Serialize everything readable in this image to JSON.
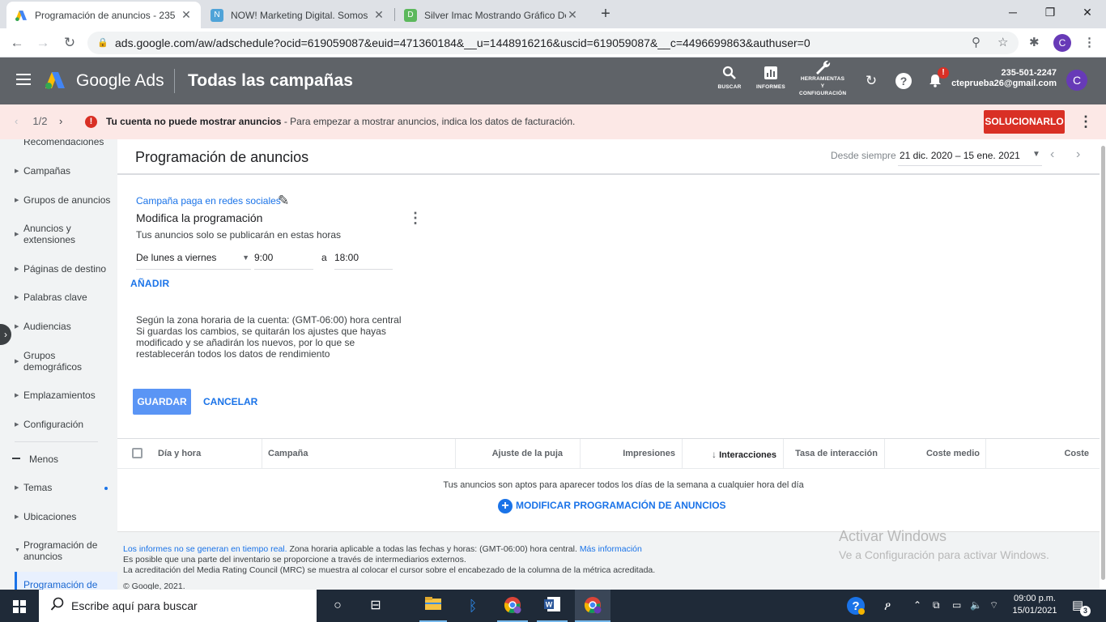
{
  "browser": {
    "tabs": [
      {
        "title": "Programación de anuncios - 235",
        "active": true,
        "favicon": "google-ads-icon"
      },
      {
        "title": "NOW! Marketing Digital. Somos",
        "active": false,
        "favicon": "now-marketing-icon"
      },
      {
        "title": "Silver Imac Mostrando Gráfico De",
        "active": false,
        "favicon": "d-icon"
      }
    ],
    "url": "ads.google.com/aw/adschedule?ocid=619059087&euid=471360184&__u=1448916216&uscid=619059087&__c=4496699863&authuser=0",
    "profile_initial": "C"
  },
  "header": {
    "brand": "Google Ads",
    "title": "Todas las campañas",
    "tools": [
      {
        "label": "BUSCAR",
        "icon": "search-icon"
      },
      {
        "label": "INFORMES",
        "icon": "reports-icon"
      },
      {
        "label": "HERRAMIENTAS Y CONFIGURACIÓN",
        "icon": "wrench-icon"
      }
    ],
    "notification_badge": "!",
    "account_id": "235-501-2247",
    "account_email": "cteprueba26@gmail.com",
    "avatar_initial": "C"
  },
  "alert": {
    "pager": "1/2",
    "title": "Tu cuenta no puede mostrar anuncios",
    "message": " - Para empezar a mostrar anuncios, indica los datos de facturación.",
    "button": "SOLUCIONARLO"
  },
  "sidebar": {
    "items": [
      {
        "label": "Recomendaciones"
      },
      {
        "label": "Campañas"
      },
      {
        "label": "Grupos de anuncios"
      },
      {
        "label": "Anuncios y extensiones"
      },
      {
        "label": "Páginas de destino"
      },
      {
        "label": "Palabras clave"
      },
      {
        "label": "Audiencias"
      },
      {
        "label": "Grupos demográficos"
      },
      {
        "label": "Emplazamientos"
      },
      {
        "label": "Configuración"
      }
    ],
    "less_label": "Menos",
    "more_items": [
      {
        "label": "Temas"
      },
      {
        "label": "Ubicaciones"
      },
      {
        "label": "Programación de anuncios"
      }
    ],
    "active_item": "Programación de"
  },
  "main": {
    "title": "Programación de anuncios",
    "date_range_label": "Desde siempre",
    "date_range_value": "21 dic. 2020 – 15 ene. 2021",
    "campaign_link": "Campaña paga en redes sociales",
    "schedule_title": "Modifica la programación",
    "schedule_subtitle": "Tus anuncios solo se publicarán en estas horas",
    "days_value": "De lunes a viernes",
    "start_time": "9:00",
    "to_label": "a",
    "end_time": "18:00",
    "add_label": "AÑADIR",
    "timezone_note": "Según la zona horaria de la cuenta: (GMT-06:00) hora central",
    "warning_note": "Si guardas los cambios, se quitarán los ajustes que hayas modificado y se añadirán los nuevos, por lo que se restablecerán todos los datos de rendimiento",
    "save_label": "GUARDAR",
    "cancel_label": "CANCELAR"
  },
  "table": {
    "columns": [
      "Día y hora",
      "Campaña",
      "Ajuste de la puja",
      "Impresiones",
      "Interacciones",
      "Tasa de interacción",
      "Coste medio",
      "Coste"
    ],
    "sorted_column": "Interacciones",
    "empty_message": "Tus anuncios son aptos para aparecer todos los días de la semana a cualquier hora del día",
    "modify_link": "MODIFICAR PROGRAMACIÓN DE ANUNCIOS"
  },
  "footer": {
    "line1_link": "Los informes no se generan en tiempo real.",
    "line1_text": " Zona horaria aplicable a todas las fechas y horas: (GMT-06:00) hora central. ",
    "line1_more": "Más información",
    "line2": "Es posible que una parte del inventario se proporcione a través de intermediarios externos.",
    "line3": "La acreditación del Media Rating Council (MRC) se muestra al colocar el cursor sobre el encabezado de la columna de la métrica acreditada.",
    "copyright": "© Google, 2021."
  },
  "watermark": {
    "title": "Activar Windows",
    "subtitle": "Ve a Configuración para activar Windows."
  },
  "taskbar": {
    "search_placeholder": "Escribe aquí para buscar",
    "time": "09:00 p.m.",
    "date": "15/01/2021",
    "notification_count": "3"
  },
  "colors": {
    "accent": "#1a73e8",
    "header_bg": "#5f6368",
    "alert_bg": "#fce8e6",
    "error": "#d93025"
  }
}
